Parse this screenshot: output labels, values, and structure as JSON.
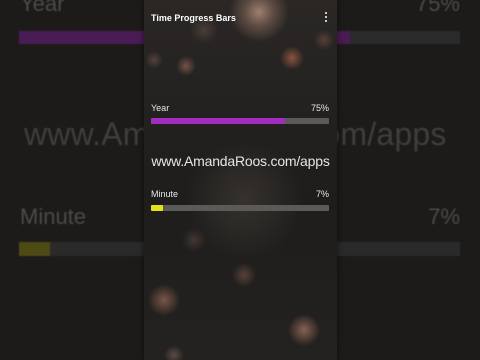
{
  "background": {
    "year": {
      "label": "Year",
      "percent_text": "75%",
      "progress": 0.75
    },
    "url": "www.AmandaRoos.com/apps",
    "minute": {
      "label": "Minute",
      "percent_text": "7%",
      "progress": 0.07
    }
  },
  "app": {
    "title": "Time Progress Bars",
    "menu_icon": "more-vert-icon"
  },
  "bars": {
    "year": {
      "label": "Year",
      "percent_text": "75%",
      "progress": 0.75,
      "color": "#a32cc0"
    },
    "minute": {
      "label": "Minute",
      "percent_text": "7%",
      "progress": 0.07,
      "color": "#e4e21a"
    }
  },
  "overlay_url": "www.AmandaRoos.com/apps",
  "colors": {
    "track": "#5b5a59",
    "text": "#e8e8e8"
  }
}
